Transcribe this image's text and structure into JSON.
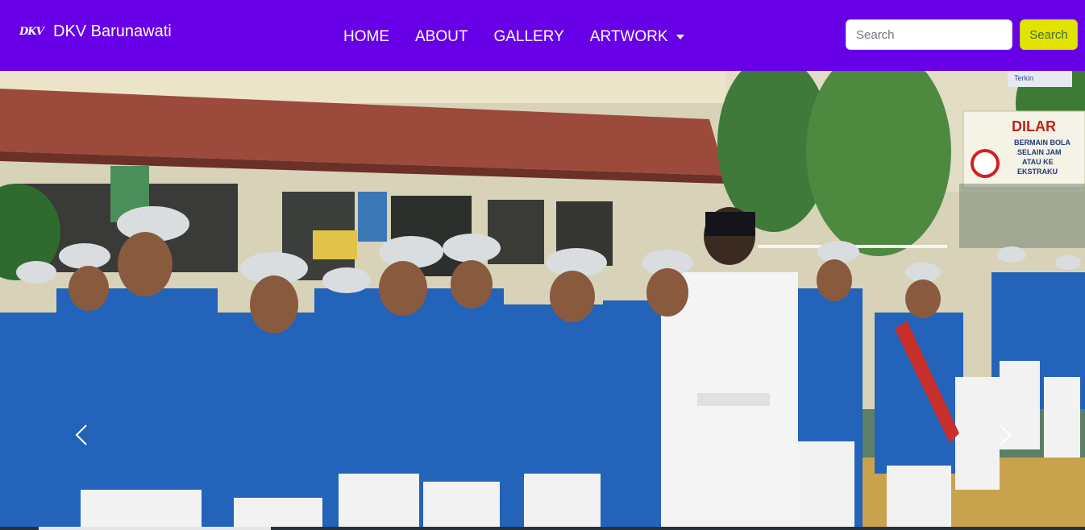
{
  "theme": {
    "nav_bg": "#6700e7",
    "search_button_bg": "#e3e300",
    "text_on_nav": "#ffffff"
  },
  "brand": {
    "logo_text": "DKV",
    "name": "DKV Barunawati"
  },
  "nav": {
    "items": [
      {
        "label": "HOME"
      },
      {
        "label": "ABOUT"
      },
      {
        "label": "GALLERY"
      },
      {
        "label": "ARTWORK",
        "has_dropdown": true
      }
    ]
  },
  "search": {
    "placeholder": "Search",
    "button_label": "Search"
  },
  "carousel": {
    "image_description_icon": "photo",
    "signs": {
      "banner_main": "DILAR",
      "banner_line1": "BERMAIN BOLA",
      "banner_line2": "SELAIN JAM",
      "banner_line3": "ATAU KE",
      "banner_line4": "EKSTRAKU",
      "small_sign": "Terkin"
    },
    "prev_icon": "chevron-left-icon",
    "next_icon": "chevron-right-icon",
    "slide_count": 4,
    "active_slide": 1
  }
}
